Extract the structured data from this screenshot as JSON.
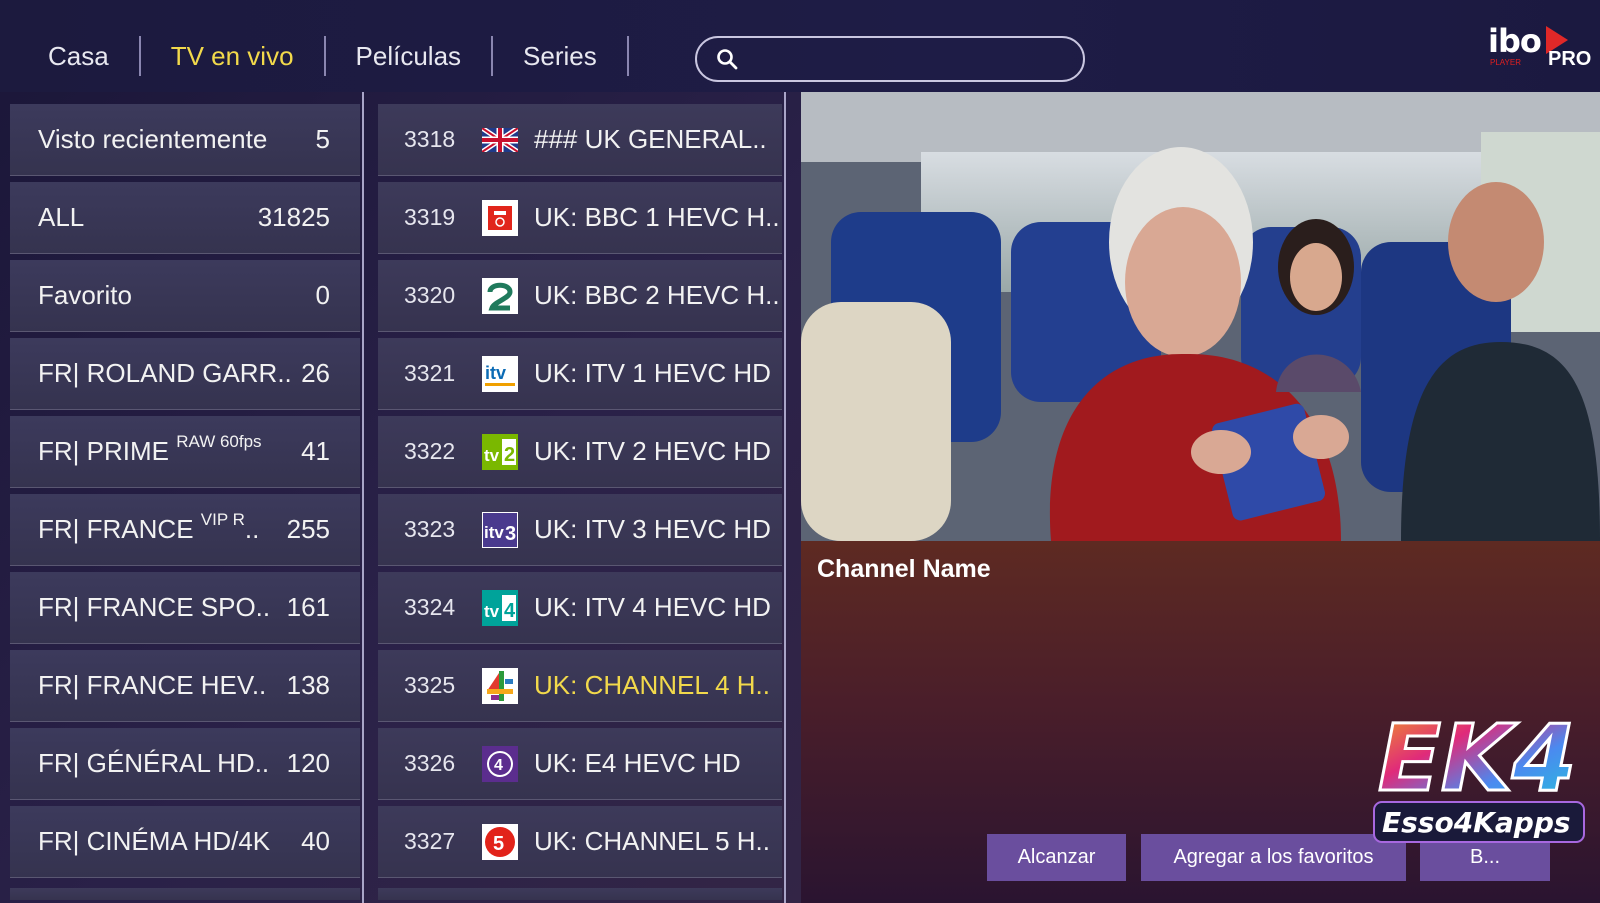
{
  "nav": {
    "items": [
      {
        "label": "Casa",
        "active": false
      },
      {
        "label": "TV en vivo",
        "active": true
      },
      {
        "label": "Películas",
        "active": false
      },
      {
        "label": "Series",
        "active": false
      }
    ]
  },
  "search": {
    "value": "",
    "placeholder": ""
  },
  "logo": {
    "brand": "ibo",
    "suffix": "PRO",
    "sub": "PLAYER"
  },
  "categories": [
    {
      "label": "Visto recientemente",
      "count": "5"
    },
    {
      "label": "ALL",
      "count": "31825"
    },
    {
      "label": "Favorito",
      "count": "0"
    },
    {
      "label": "FR| ROLAND GARR..",
      "count": "26"
    },
    {
      "label": "FR| PRIME ",
      "sup": "RAW 60fps",
      "count": "41"
    },
    {
      "label": "FR| FRANCE ",
      "sup": "VIP R",
      "tail": "..",
      "count": "255"
    },
    {
      "label": "FR| FRANCE SPO..",
      "count": "161"
    },
    {
      "label": "FR| FRANCE HEV..",
      "count": "138"
    },
    {
      "label": "FR| GÉNÉRAL HD..",
      "count": "120"
    },
    {
      "label": "FR| CINÉMA HD/4K",
      "count": "40"
    }
  ],
  "channels": [
    {
      "num": "3318",
      "icon": "uk-flag-icon",
      "name": "### UK GENERAL..",
      "selected": false
    },
    {
      "num": "3319",
      "icon": "bbc-one-logo-icon",
      "name": "UK: BBC 1 HEVC H..",
      "selected": false
    },
    {
      "num": "3320",
      "icon": "bbc-two-logo-icon",
      "name": "UK: BBC 2 HEVC H..",
      "selected": false
    },
    {
      "num": "3321",
      "icon": "itv1-logo-icon",
      "name": "UK: ITV 1 HEVC HD",
      "selected": false
    },
    {
      "num": "3322",
      "icon": "itv2-logo-icon",
      "name": "UK: ITV 2 HEVC HD",
      "selected": false
    },
    {
      "num": "3323",
      "icon": "itv3-logo-icon",
      "name": "UK: ITV 3 HEVC HD",
      "selected": false
    },
    {
      "num": "3324",
      "icon": "itv4-logo-icon",
      "name": "UK: ITV 4 HEVC HD",
      "selected": false
    },
    {
      "num": "3325",
      "icon": "channel4-logo-icon",
      "name": "UK: CHANNEL 4 H..",
      "selected": true
    },
    {
      "num": "3326",
      "icon": "e4-logo-icon",
      "name": "UK: E4 HEVC HD",
      "selected": false
    },
    {
      "num": "3327",
      "icon": "channel5-logo-icon",
      "name": "UK: CHANNEL 5 H..",
      "selected": false
    }
  ],
  "info": {
    "channel_name": "Channel Name",
    "btn_catchup": "Alcanzar",
    "btn_favorite": "Agregar a los favoritos",
    "btn_third": "B..."
  },
  "watermark": {
    "title": "EK4",
    "subtitle": "Esso4Kapps"
  },
  "colors": {
    "accent": "#f2d94b",
    "button": "#6a4e9e",
    "row": "#3a3858"
  }
}
